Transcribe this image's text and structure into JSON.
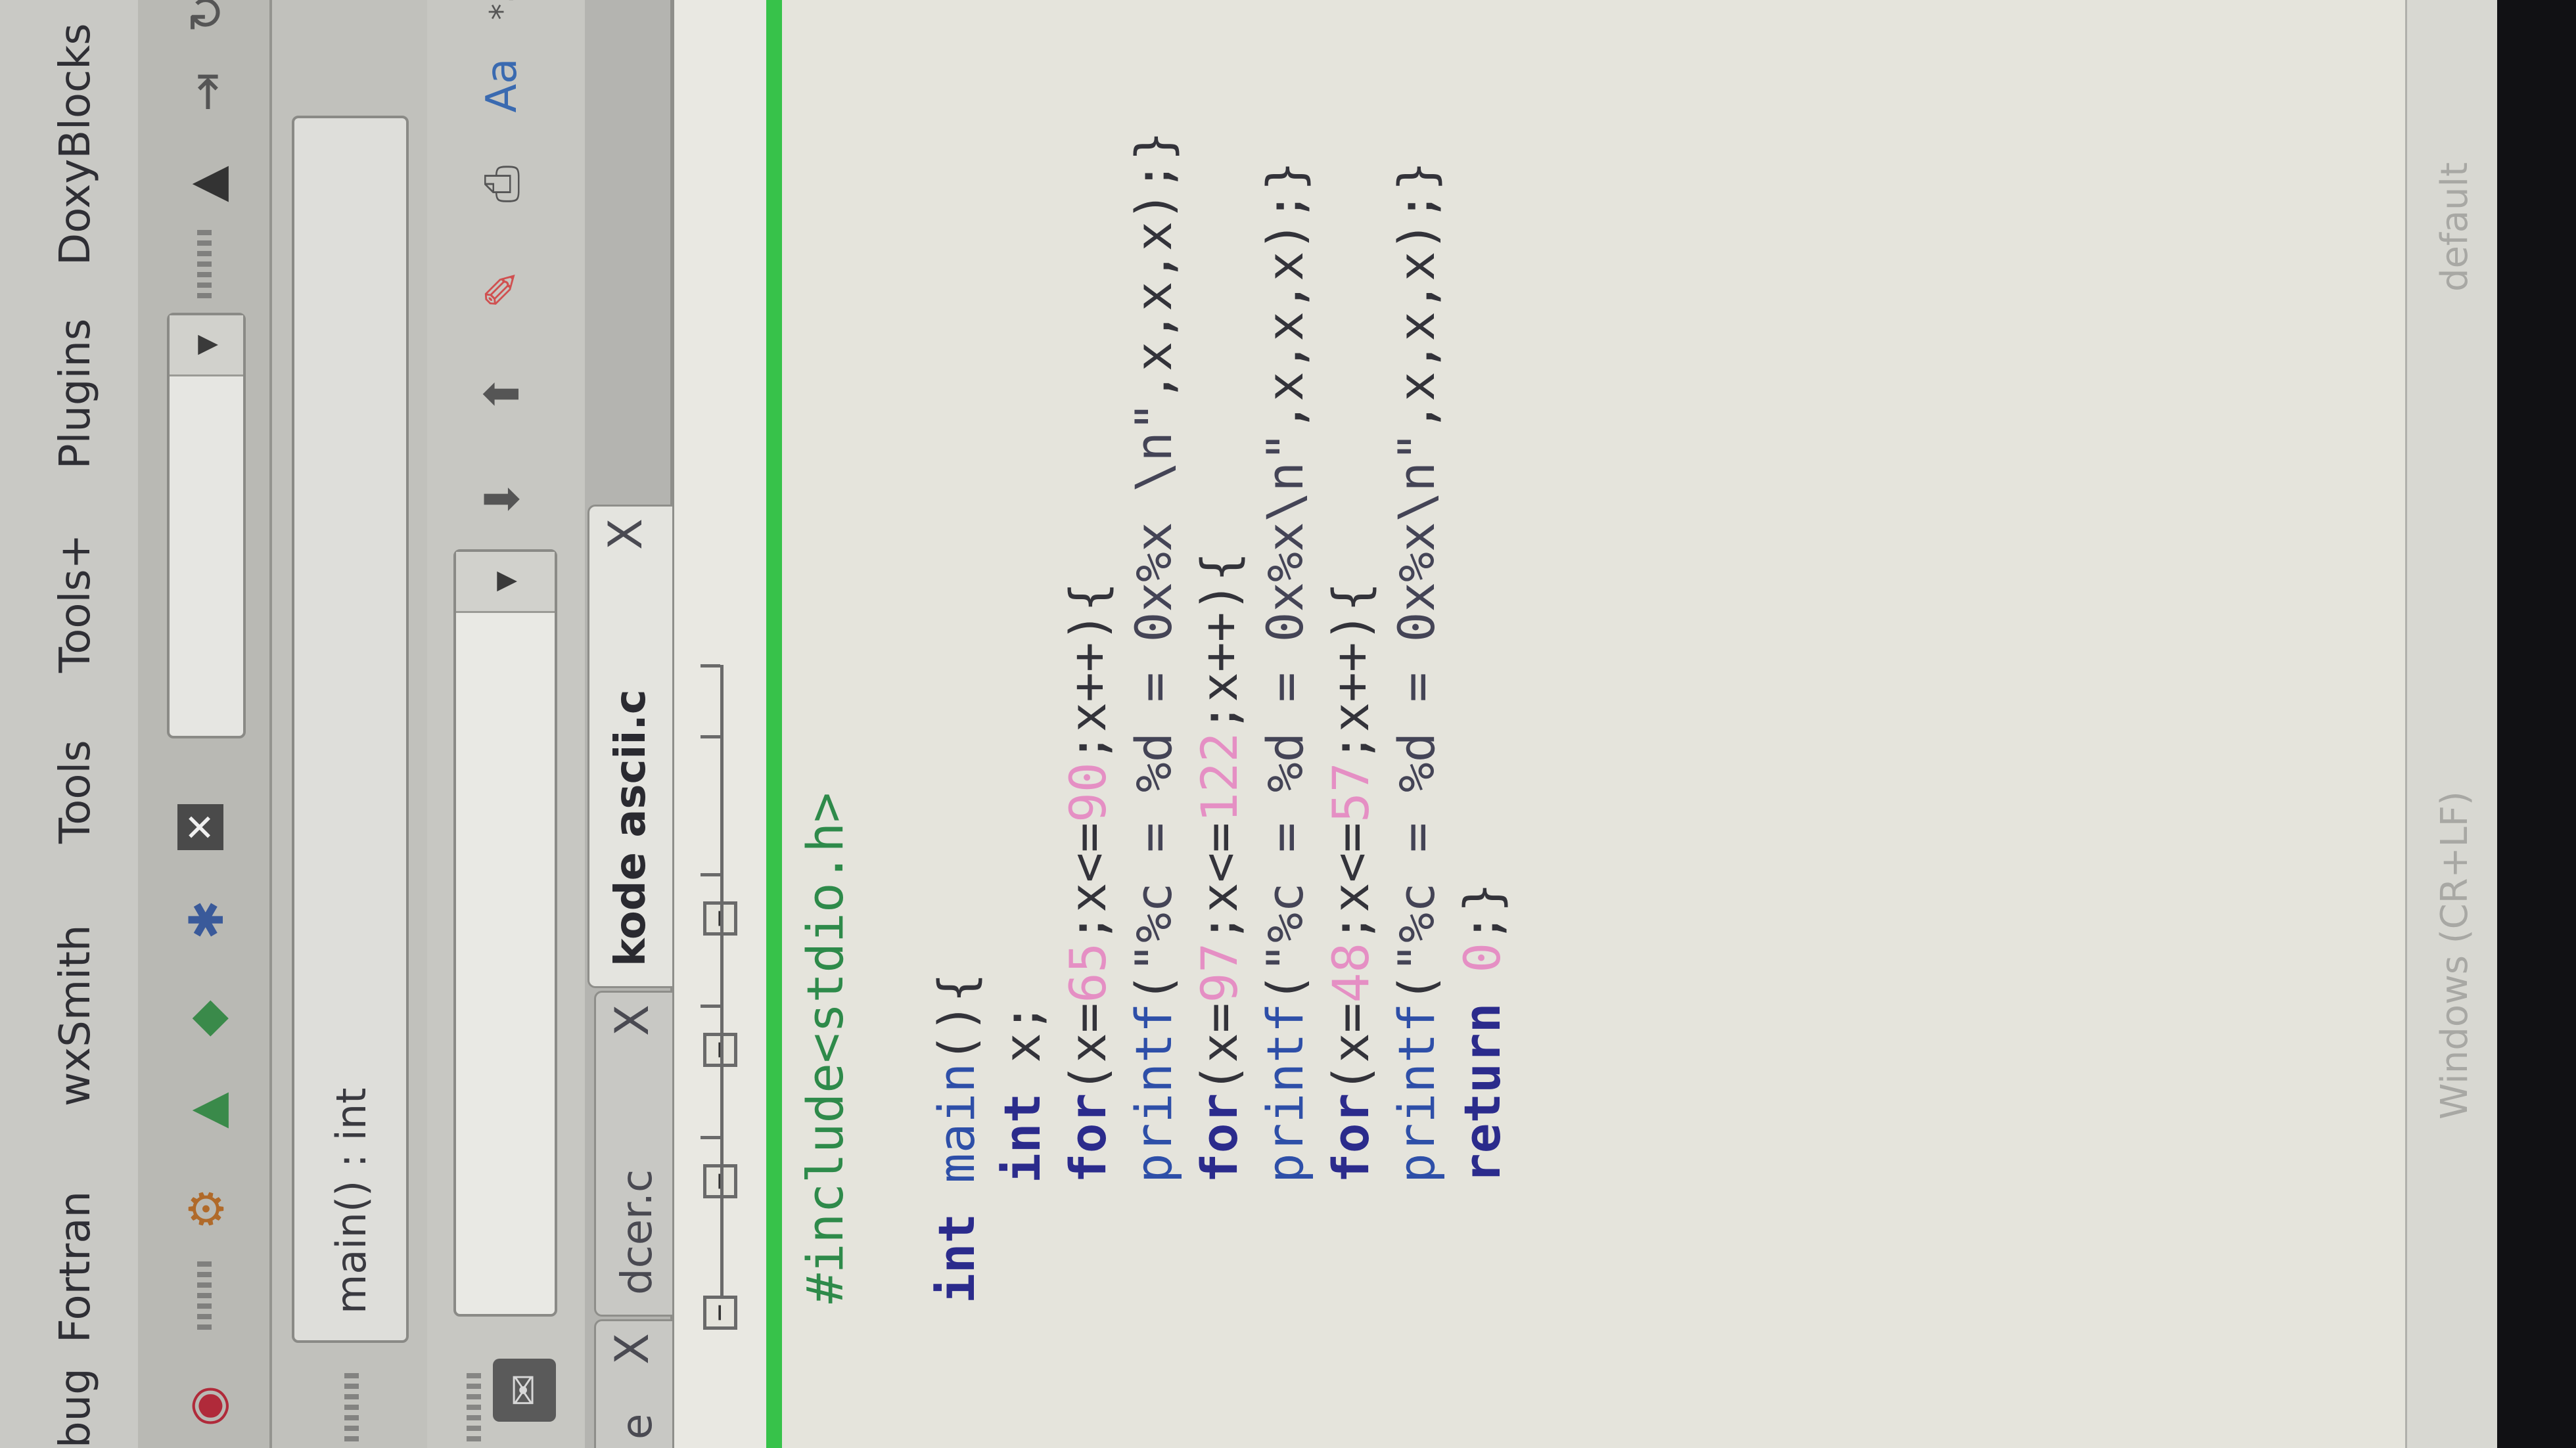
{
  "menu": {
    "items": [
      "bug",
      "Fortran",
      "wxSmith",
      "Tools",
      "Tools+",
      "Plugins",
      "DoxyBlocks"
    ]
  },
  "scope": {
    "current": "main() : int"
  },
  "tabs": [
    {
      "label": "e",
      "active": false
    },
    {
      "label": "dcer.c",
      "active": false
    },
    {
      "label": "kode ascii.c",
      "active": true
    }
  ],
  "tab_close_glyph": "X",
  "code": {
    "lines": [
      "#include<stdio.h>",
      "",
      "int main(){",
      "    int x;",
      "    for(x=65;x<=90;x++){",
      "    printf(\"%c = %d = 0x%x \\n\",x,x,x);}",
      "    for(x=97;x<=122;x++){",
      "    printf(\"%c = %d = 0x%x\\n\",x,x,x);}",
      "    for(x=48;x<=57;x++){",
      "    printf(\"%c = %d = 0x%x\\n\",x,x,x);}",
      "    return 0;}"
    ]
  },
  "status": {
    "line_endings": "Windows (CR+LF)",
    "encoding": "default"
  },
  "colors": {
    "change_bar": "#37c24a",
    "brace_highlight": "#5fc9c0",
    "numbers": "#e58fc4",
    "keywords": "#2b2b8c"
  }
}
